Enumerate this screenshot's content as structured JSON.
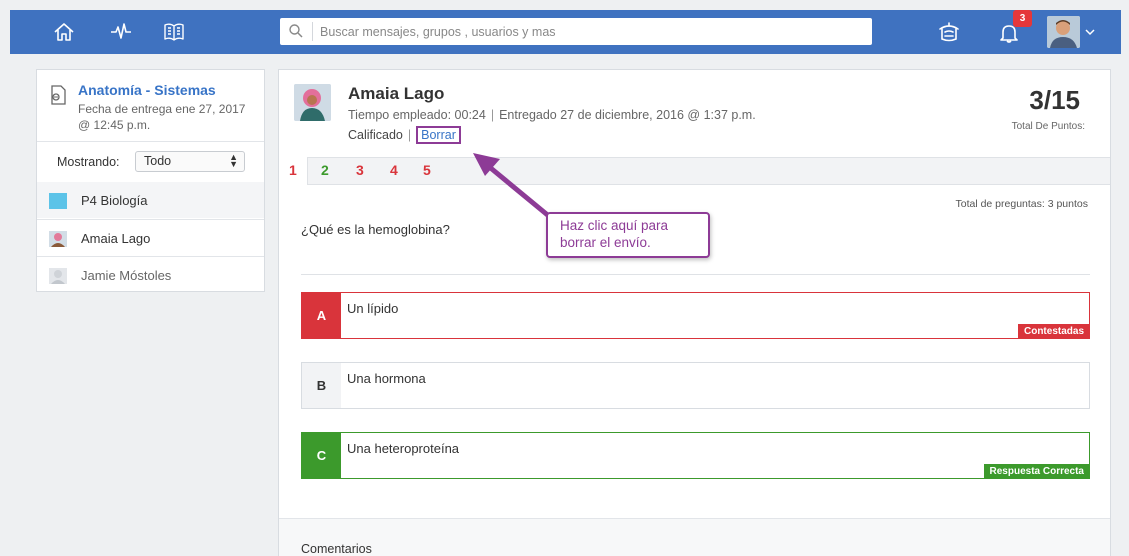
{
  "topbar": {
    "search_placeholder": "Buscar mensajes, grupos , usuarios y mas",
    "notification_count": "3",
    "bg_color": "#3f72c0"
  },
  "assignment": {
    "title": "Anatomía - Sistemas",
    "due": "Fecha de entrega ene 27, 2017 @ 12:45 p.m."
  },
  "filter": {
    "label": "Mostrando:",
    "value": "Todo"
  },
  "students": [
    {
      "name": "P4 Biología"
    },
    {
      "name": "Amaia Lago"
    },
    {
      "name": "Jamie Móstoles"
    }
  ],
  "submission": {
    "student": "Amaia Lago",
    "time_spent": "Tiempo empleado: 00:24",
    "delivered": "Entregado 27 de diciembre, 2016 @ 1:37 p.m.",
    "status": "Calificado",
    "delete_link": "Borrar",
    "score": "3/15",
    "score_label": "Total De Puntos:"
  },
  "tabs": [
    "1",
    "2",
    "3",
    "4",
    "5"
  ],
  "question": {
    "total": "Total de preguntas: 3 puntos",
    "text": "¿Qué es la hemoglobina?",
    "options": [
      {
        "letter": "A",
        "text": "Un lípido",
        "tag": "Contestadas"
      },
      {
        "letter": "B",
        "text": "Una hormona"
      },
      {
        "letter": "C",
        "text": "Una heteroproteína",
        "tag": "Respuesta Correcta"
      }
    ]
  },
  "comments_label": "Comentarios",
  "callout_text": "Haz clic aquí para borrar el envío.",
  "colors": {
    "accent": "#3874c7",
    "wrong": "#d9343b",
    "correct": "#3c9a2c",
    "callout": "#8d3b96"
  }
}
